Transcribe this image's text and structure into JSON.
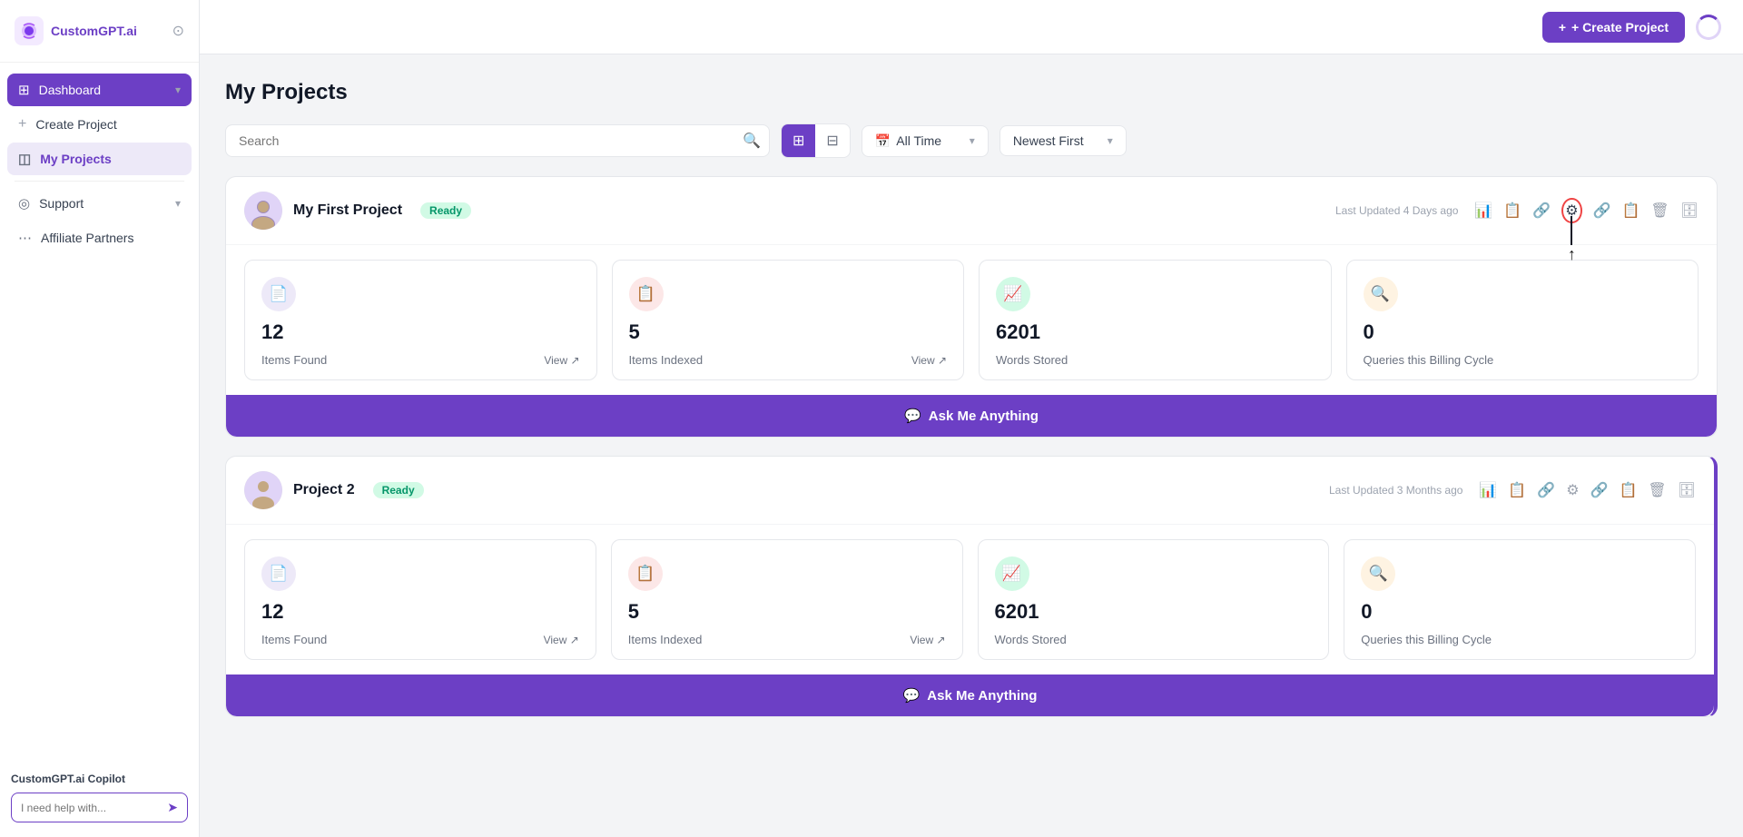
{
  "brand": {
    "name": "CustomGPT.ai"
  },
  "topbar": {
    "create_button": "+ Create Project"
  },
  "sidebar": {
    "dashboard_label": "Dashboard",
    "create_project_label": "Create Project",
    "my_projects_label": "My Projects",
    "support_label": "Support",
    "affiliate_label": "Affiliate Partners",
    "copilot_label": "CustomGPT.ai Copilot",
    "copilot_placeholder": "I need help with..."
  },
  "page": {
    "title": "My Projects"
  },
  "filters": {
    "search_placeholder": "Search",
    "time_filter": "All Time",
    "sort_filter": "Newest First"
  },
  "projects": [
    {
      "id": 1,
      "name": "My First Project",
      "status": "Ready",
      "updated": "Last Updated 4 Days ago",
      "stats": [
        {
          "number": "12",
          "label": "Items Found",
          "has_view": true
        },
        {
          "number": "5",
          "label": "Items Indexed",
          "has_view": true
        },
        {
          "number": "6201",
          "label": "Words Stored",
          "has_view": false
        },
        {
          "number": "0",
          "label": "Queries this Billing Cycle",
          "has_view": false
        }
      ],
      "ask_bar_label": "Ask Me Anything",
      "highlighted_action": "settings"
    },
    {
      "id": 2,
      "name": "Project 2",
      "status": "Ready",
      "updated": "Last Updated 3 Months ago",
      "stats": [
        {
          "number": "12",
          "label": "Items Found",
          "has_view": true
        },
        {
          "number": "5",
          "label": "Items Indexed",
          "has_view": true
        },
        {
          "number": "6201",
          "label": "Words Stored",
          "has_view": false
        },
        {
          "number": "0",
          "label": "Queries this Billing Cycle",
          "has_view": false
        }
      ],
      "ask_bar_label": "Ask Me Anything",
      "highlighted_action": null
    }
  ],
  "stat_icons": [
    "📄",
    "📋",
    "📈",
    "🔍"
  ],
  "stat_icon_classes": [
    "stat-icon-purple",
    "stat-icon-pink",
    "stat-icon-green",
    "stat-icon-orange"
  ],
  "view_label": "View",
  "actions": [
    "bar-chart",
    "grid",
    "link",
    "settings",
    "chain-link",
    "copy",
    "trash",
    "archive"
  ]
}
